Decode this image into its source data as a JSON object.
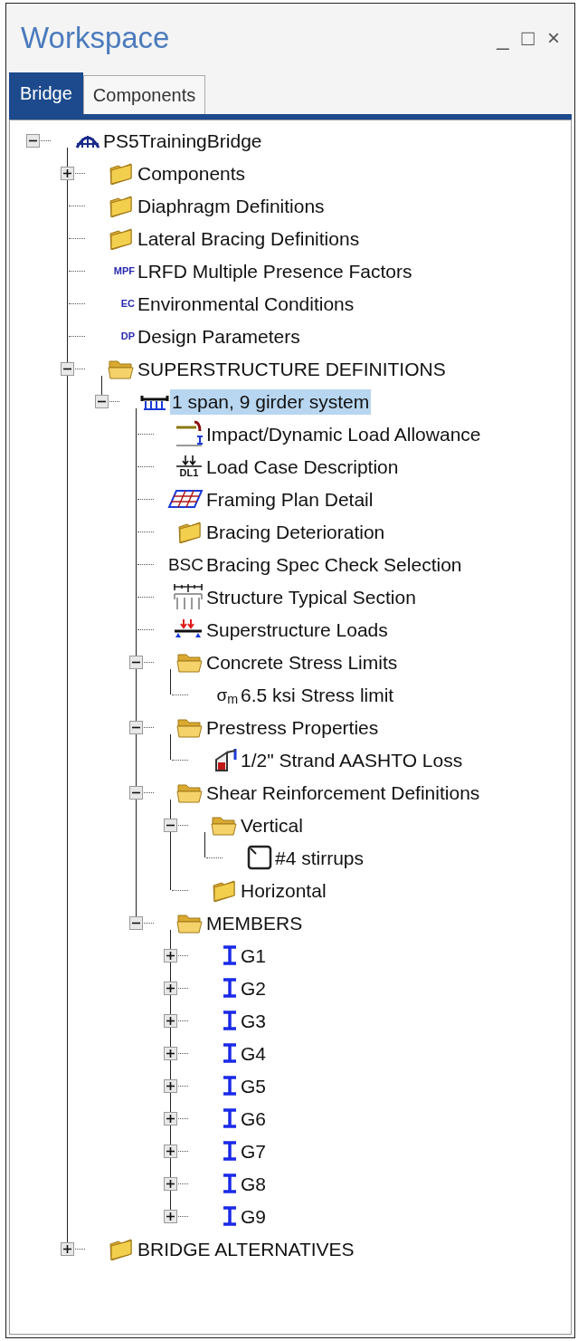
{
  "window": {
    "title": "Workspace",
    "controls": [
      "_",
      "□",
      "×"
    ]
  },
  "tabs": [
    {
      "label": "Bridge",
      "selected": true
    },
    {
      "label": "Components",
      "selected": false
    }
  ],
  "tree": [
    {
      "label": "PS5TrainingBridge",
      "kind": "bridge",
      "expanded": true,
      "selected": false,
      "children": [
        {
          "label": "Components",
          "kind": "folder",
          "expanded": false,
          "selected": false
        },
        {
          "label": "Diaphragm Definitions",
          "kind": "folder",
          "selected": false
        },
        {
          "label": "Lateral Bracing Definitions",
          "kind": "folder",
          "selected": false
        },
        {
          "label": "LRFD Multiple Presence Factors",
          "kind": "text-icon",
          "icon_text": "MPF",
          "selected": false
        },
        {
          "label": "Environmental Conditions",
          "kind": "text-icon",
          "icon_text": "EC",
          "selected": false
        },
        {
          "label": "Design Parameters",
          "kind": "text-icon",
          "icon_text": "DP",
          "selected": false
        },
        {
          "label": "SUPERSTRUCTURE DEFINITIONS",
          "kind": "folder",
          "expanded": true,
          "selected": false,
          "children": [
            {
              "label": "1 span, 9 girder system",
              "kind": "system",
              "expanded": true,
              "selected": true,
              "children": [
                {
                  "label": "Impact/Dynamic Load Allowance",
                  "kind": "impact",
                  "selected": false
                },
                {
                  "label": "Load Case Description",
                  "kind": "loadcase",
                  "icon_text": "DL1",
                  "selected": false
                },
                {
                  "label": "Framing Plan Detail",
                  "kind": "framing",
                  "selected": false
                },
                {
                  "label": "Bracing Deterioration",
                  "kind": "folder",
                  "selected": false
                },
                {
                  "label": "Bracing Spec Check Selection",
                  "kind": "text-icon-plain",
                  "icon_text": "BSC",
                  "selected": false
                },
                {
                  "label": "Structure Typical Section",
                  "kind": "section",
                  "selected": false
                },
                {
                  "label": "Superstructure Loads",
                  "kind": "loads",
                  "selected": false
                },
                {
                  "label": "Concrete Stress Limits",
                  "kind": "folder",
                  "expanded": true,
                  "selected": false,
                  "children": [
                    {
                      "label": "6.5 ksi Stress limit",
                      "kind": "text-icon-plain",
                      "icon_text": "σ$_{m}$",
                      "selected": false
                    }
                  ]
                },
                {
                  "label": "Prestress Properties",
                  "kind": "folder",
                  "expanded": true,
                  "selected": false,
                  "children": [
                    {
                      "label": "1/2\" Strand AASHTO Loss",
                      "kind": "strand",
                      "selected": false
                    }
                  ]
                },
                {
                  "label": "Shear Reinforcement Definitions",
                  "kind": "folder",
                  "expanded": true,
                  "selected": false,
                  "children": [
                    {
                      "label": "Vertical",
                      "kind": "folder",
                      "expanded": true,
                      "selected": false,
                      "children": [
                        {
                          "label": "#4 stirrups",
                          "kind": "stirrup",
                          "selected": false
                        }
                      ]
                    },
                    {
                      "label": "Horizontal",
                      "kind": "folder",
                      "selected": false
                    }
                  ]
                },
                {
                  "label": "MEMBERS",
                  "kind": "folder",
                  "expanded": true,
                  "selected": false,
                  "children": [
                    {
                      "label": "G1",
                      "kind": "girder",
                      "expanded": false,
                      "selected": false
                    },
                    {
                      "label": "G2",
                      "kind": "girder",
                      "expanded": false,
                      "selected": false
                    },
                    {
                      "label": "G3",
                      "kind": "girder",
                      "expanded": false,
                      "selected": false
                    },
                    {
                      "label": "G4",
                      "kind": "girder",
                      "expanded": false,
                      "selected": false
                    },
                    {
                      "label": "G5",
                      "kind": "girder",
                      "expanded": false,
                      "selected": false
                    },
                    {
                      "label": "G6",
                      "kind": "girder",
                      "expanded": false,
                      "selected": false
                    },
                    {
                      "label": "G7",
                      "kind": "girder",
                      "expanded": false,
                      "selected": false
                    },
                    {
                      "label": "G8",
                      "kind": "girder",
                      "expanded": false,
                      "selected": false
                    },
                    {
                      "label": "G9",
                      "kind": "girder",
                      "expanded": false,
                      "selected": false
                    }
                  ]
                }
              ]
            }
          ]
        },
        {
          "label": "BRIDGE ALTERNATIVES",
          "kind": "folder",
          "expanded": false,
          "selected": false
        }
      ]
    }
  ]
}
